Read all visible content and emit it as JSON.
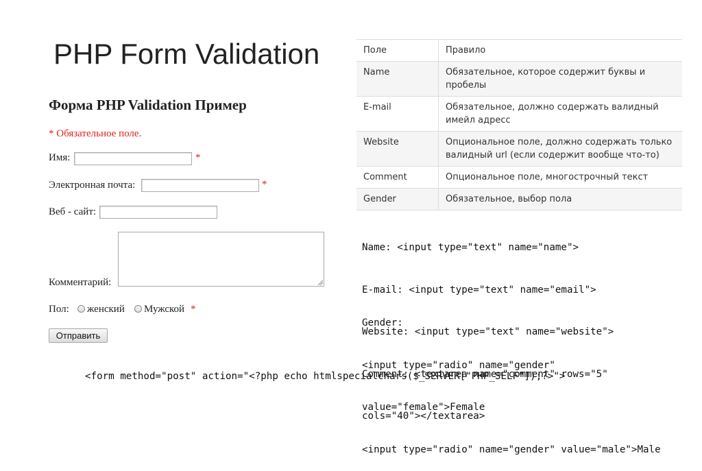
{
  "slide": {
    "title": "PHP Form Validation"
  },
  "form": {
    "heading": "Форма PHP Validation Пример",
    "required_note": "* Обязательное поле.",
    "name_label": "Имя:",
    "email_label": "Электронная почта:",
    "website_label": "Веб - сайт:",
    "comment_label": "Комментарий:",
    "gender_label": "Пол:",
    "female_label": "женский",
    "male_label": "Мужской",
    "required_mark": "*",
    "submit_label": "Отправить"
  },
  "rules_table": {
    "header": [
      "Поле",
      "Правило"
    ],
    "rows": [
      [
        "Name",
        "Обязательное, которое содержит буквы и пробелы"
      ],
      [
        "E-mail",
        "Обязательное, должно содержать валидный имейл адресс"
      ],
      [
        "Website",
        "Опциональное поле, должно содержать только валидный url (если содержит вообще что-то)"
      ],
      [
        "Comment",
        "Опциональное поле, многострочный текст"
      ],
      [
        "Gender",
        "Обязательное, выбор пола"
      ]
    ]
  },
  "code": {
    "fields": [
      "Name: <input type=\"text\" name=\"name\">",
      "E-mail: <input type=\"text\" name=\"email\">",
      "Website: <input type=\"text\" name=\"website\">",
      "Comment: <textarea name=\"comment\" rows=\"5\"",
      "cols=\"40\"></textarea>"
    ],
    "gender": [
      "Gender:",
      "<input type=\"radio\" name=\"gender\"",
      "value=\"female\">Female",
      "<input type=\"radio\" name=\"gender\" value=\"male\">Male"
    ],
    "form_tag": "<form method=\"post\" action=\"<?php echo htmlspecialchars($_SERVER[\"PHP_SELF\"]);?>\">"
  },
  "colors": {
    "required": "#e02020",
    "table_stripe": "#f5f5f5",
    "table_border": "#dddddd"
  }
}
